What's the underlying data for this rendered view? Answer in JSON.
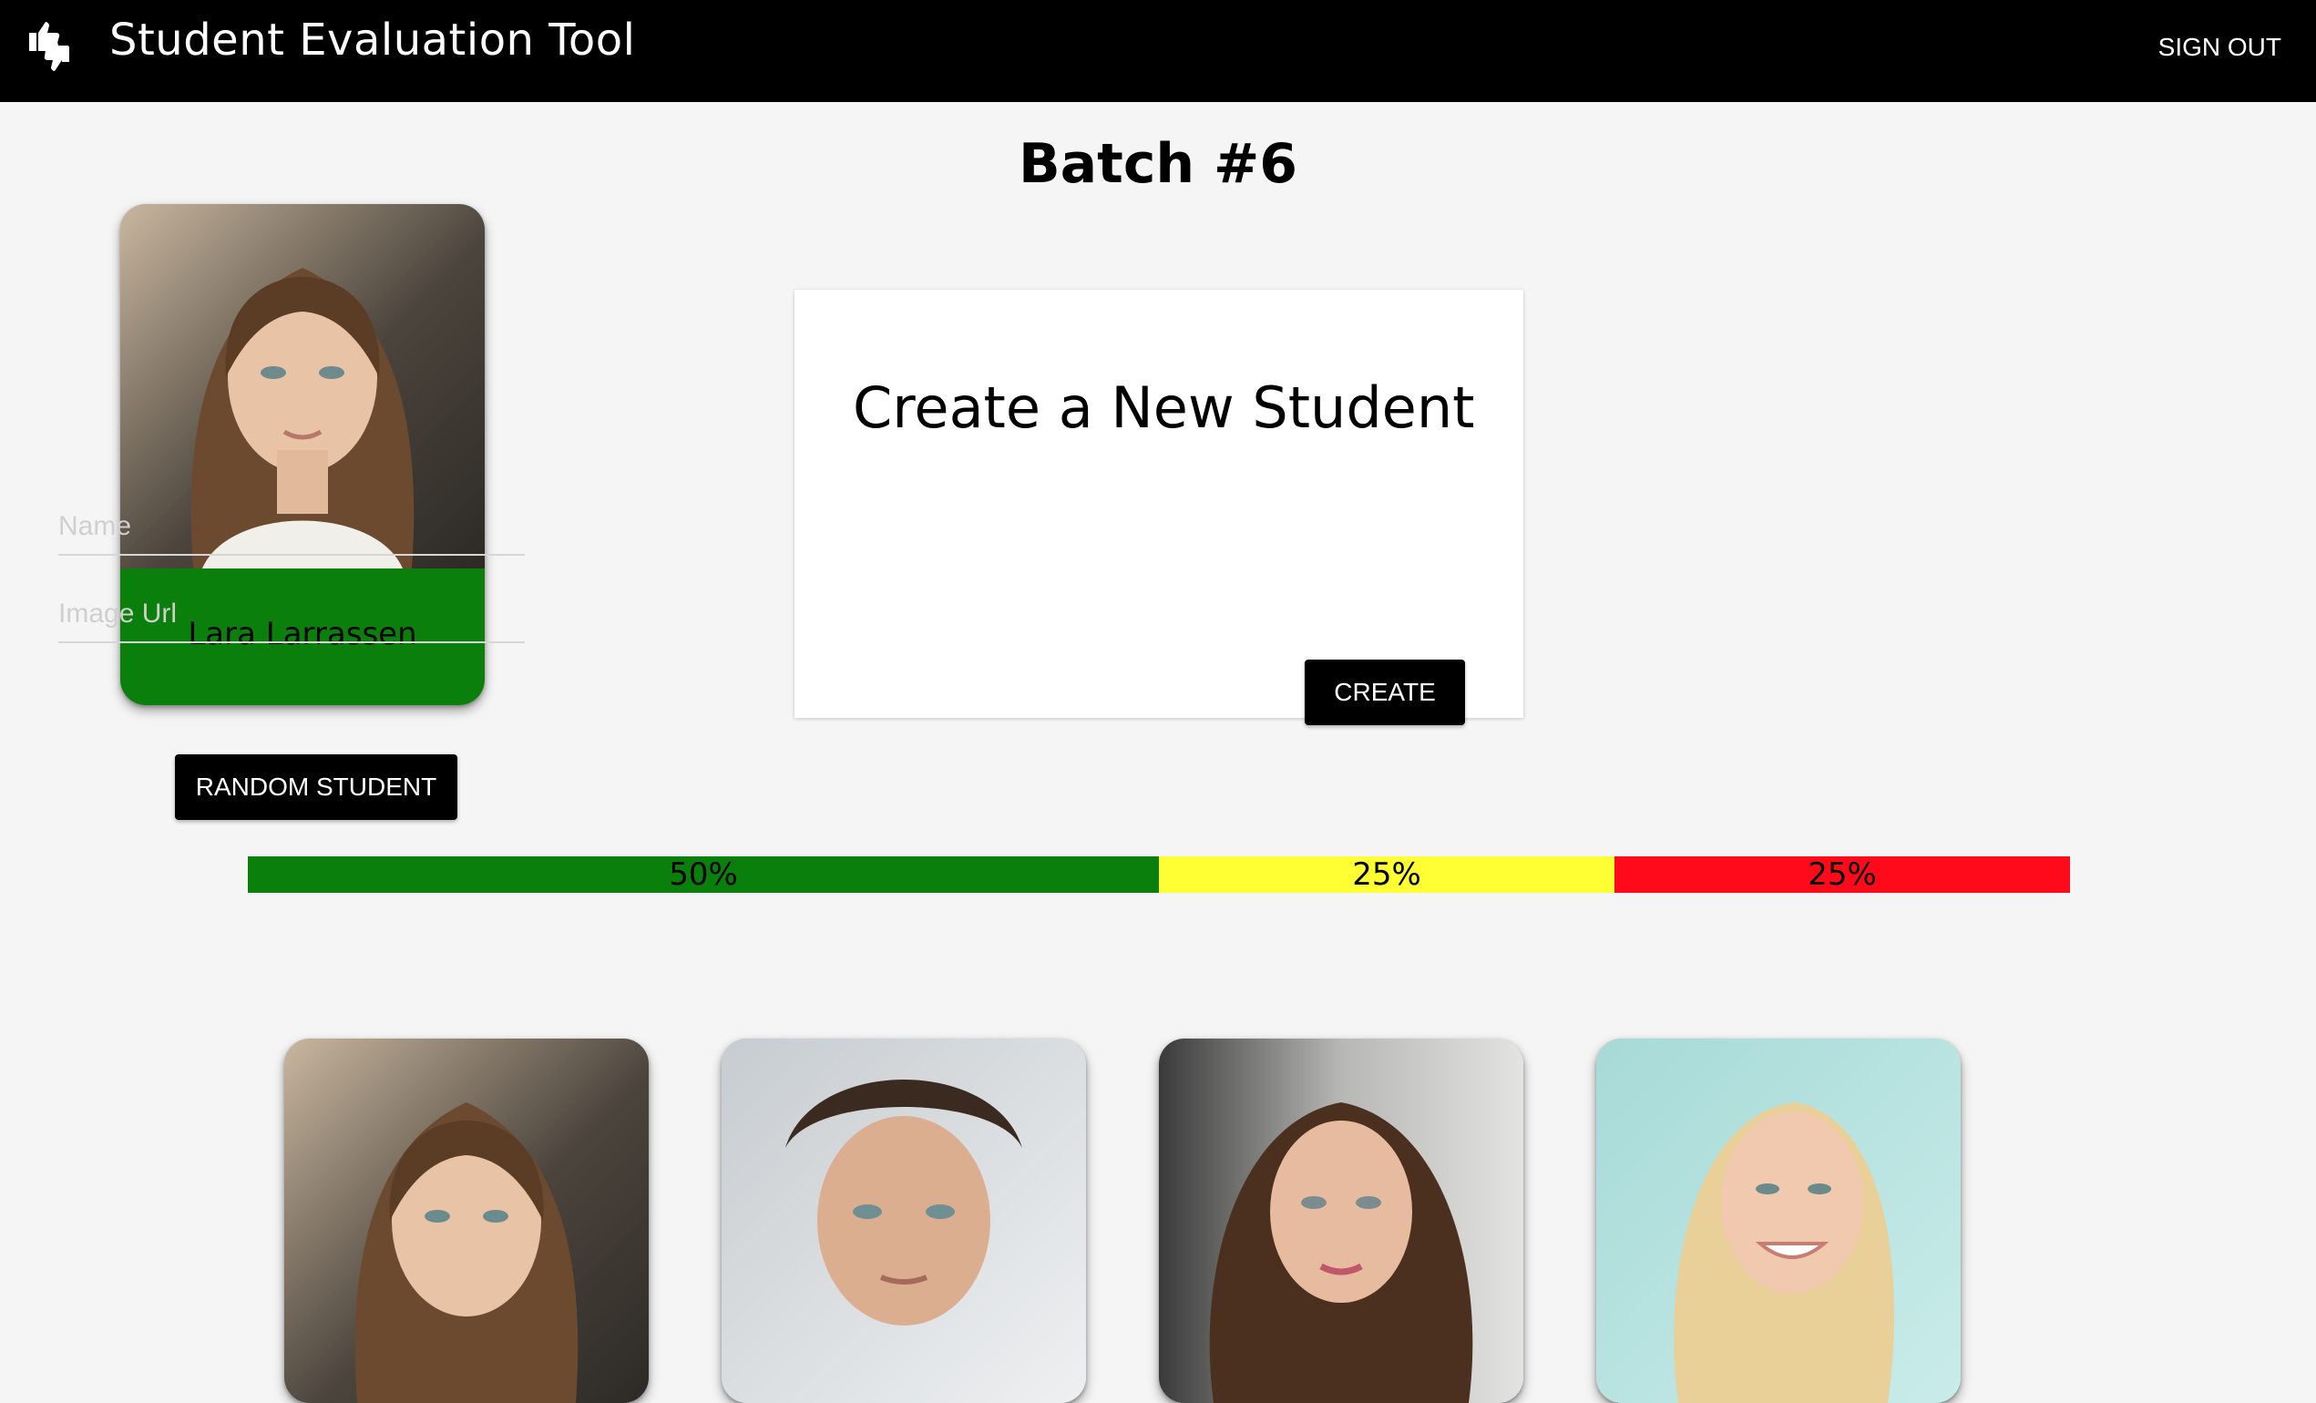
{
  "appbar": {
    "title": "Student Evaluation Tool",
    "logo_icon": "thumbs-up-down-icon",
    "signout_label": "SIGN OUT"
  },
  "batch": {
    "title": "Batch #6"
  },
  "featured_student": {
    "name": "Lara Larrassen",
    "status_color": "#0b7f0b",
    "photo_icon": "student-portrait-icon"
  },
  "random_button": {
    "label": "RANDOM STUDENT"
  },
  "create_form": {
    "heading": "Create a New Student",
    "name_placeholder": "Name",
    "name_value": "",
    "image_url_placeholder": "Image Url",
    "image_url_value": "",
    "create_label": "CREATE"
  },
  "evaluation_summary": {
    "segments": [
      {
        "label": "50%",
        "fraction": 0.5,
        "color": "#0b7f0b"
      },
      {
        "label": "25%",
        "fraction": 0.25,
        "color": "#ffff33"
      },
      {
        "label": "25%",
        "fraction": 0.25,
        "color": "#ff0a1a"
      }
    ]
  },
  "gallery": {
    "students": [
      {
        "photo_icon": "student-portrait-icon"
      },
      {
        "photo_icon": "student-portrait-icon"
      },
      {
        "photo_icon": "student-portrait-icon"
      },
      {
        "photo_icon": "student-portrait-icon"
      }
    ]
  }
}
